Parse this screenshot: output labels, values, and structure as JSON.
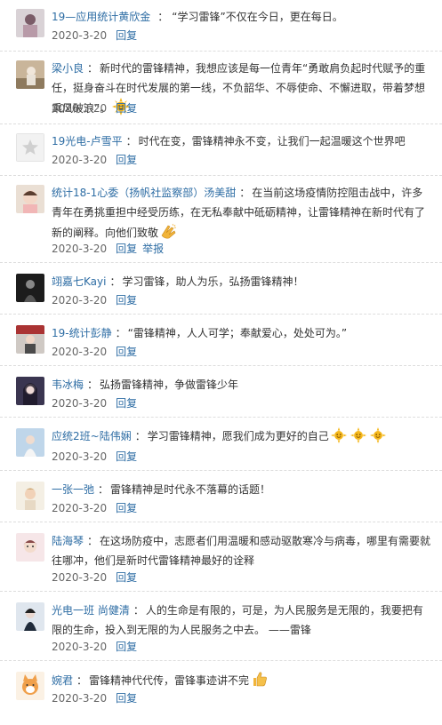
{
  "comments": [
    {
      "user": "19—应用统计黄欣金",
      "sep": "：",
      "text": "“学习雷锋”不仅在今日，更在每日。",
      "date": "2020-3-20",
      "reply": "回复"
    },
    {
      "user": "梁小良",
      "sep": "：",
      "text": "新时代的雷锋精神，我想应该是每一位青年“勇敢肩负起时代赋予的重任，挺身奋斗在时代发展的第一线，不负韶华、不辱使命、不懈进取，带着梦想乘风破浪”。",
      "date": "2020-3-20",
      "reply": "回复",
      "emoji": "sun-emoji"
    },
    {
      "user": "19光电-卢雪平",
      "sep": "：",
      "text": "时代在变，雷锋精神永不变，让我们一起温暖这个世界吧",
      "date": "2020-3-20",
      "reply": "回复"
    },
    {
      "user": "统计18-1心委（扬帆社监察部）汤美甜",
      "sep": "：",
      "text": "在当前这场疫情防控阻击战中，许多青年在勇挑重担中经受历练，在无私奉献中砥砺精神，让雷锋精神在新时代有了新的阐释。向他们致敬",
      "date": "2020-3-20",
      "reply": "回复",
      "report": "举报",
      "emoji": "clap-emoji"
    },
    {
      "user": "翊嘉七Kayi",
      "sep": "：",
      "text": "学习雷锋，助人为乐，弘扬雷锋精神！",
      "date": "2020-3-20",
      "reply": "回复"
    },
    {
      "user": "19-统计彭静",
      "sep": "：",
      "text": "“雷锋精神，人人可学；奉献爱心，处处可为。”",
      "date": "2020-3-20",
      "reply": "回复"
    },
    {
      "user": "韦冰梅",
      "sep": "：",
      "text": "弘扬雷锋精神，争做雷锋少年",
      "date": "2020-3-20",
      "reply": "回复"
    },
    {
      "user": "应统2班~陆伟娴",
      "sep": "：",
      "text": "学习雷锋精神，愿我们成为更好的自己",
      "date": "2020-3-20",
      "reply": "回复",
      "emoji": "sun-emoji-x3"
    },
    {
      "user": "一张一弛",
      "sep": "：",
      "text": "雷锋精神是时代永不落幕的话题！",
      "date": "2020-3-20",
      "reply": "回复"
    },
    {
      "user": "陆海琴",
      "sep": "：",
      "text": "在这场防疫中，志愿者们用温暖和感动驱散寒冷与病毒，哪里有需要就往哪冲，他们是新时代雷锋精神最好的诠释",
      "date": "2020-3-20",
      "reply": "回复"
    },
    {
      "user": "光电一班 尚健清",
      "sep": "：",
      "text": "人的生命是有限的，可是，为人民服务是无限的，我要把有限的生命，投入到无限的为人民服务之中去。 ——雷锋",
      "date": "2020-3-20",
      "reply": "回复"
    },
    {
      "user": "婉君",
      "sep": "：",
      "text": "雷锋精神代代传，雷锋事迹讲不完",
      "date": "2020-3-20",
      "reply": "回复",
      "emoji": "thumbs-up-emoji"
    }
  ],
  "colors": {
    "link": "#2e6da4",
    "text": "#333333",
    "meta": "#666666",
    "divider": "#dddddd"
  }
}
